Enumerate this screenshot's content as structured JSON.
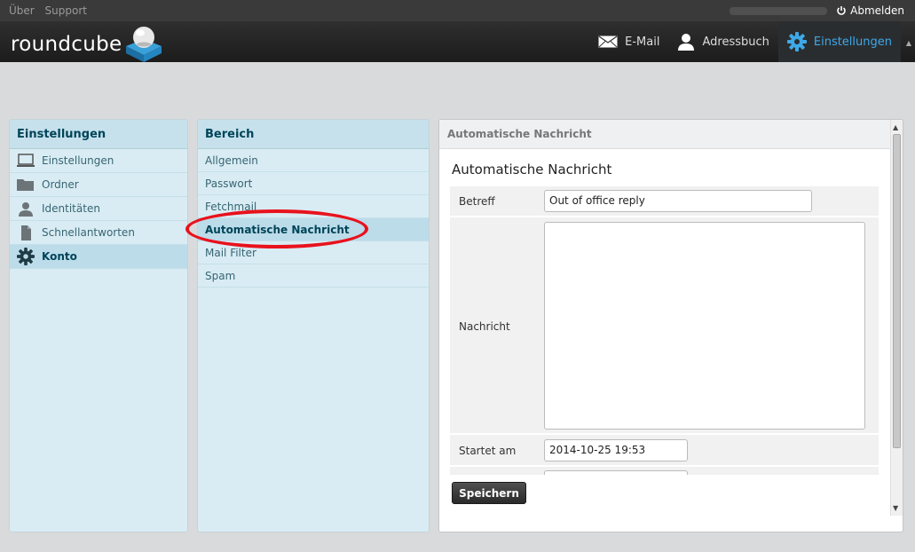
{
  "topbar": {
    "links": [
      "Über",
      "Support"
    ],
    "logout_label": "Abmelden"
  },
  "header": {
    "logo_text": "roundcube",
    "nav": [
      {
        "label": "E-Mail",
        "icon": "envelope-icon"
      },
      {
        "label": "Adressbuch",
        "icon": "person-icon"
      },
      {
        "label": "Einstellungen",
        "icon": "gear-icon",
        "active": true
      }
    ]
  },
  "settings_panel": {
    "title": "Einstellungen",
    "items": [
      {
        "label": "Einstellungen",
        "icon": "monitor-icon"
      },
      {
        "label": "Ordner",
        "icon": "folder-icon"
      },
      {
        "label": "Identitäten",
        "icon": "identity-icon"
      },
      {
        "label": "Schnellantworten",
        "icon": "document-icon"
      },
      {
        "label": "Konto",
        "icon": "gear-icon",
        "selected": true
      }
    ]
  },
  "section_panel": {
    "title": "Bereich",
    "items": [
      {
        "label": "Allgemein"
      },
      {
        "label": "Passwort"
      },
      {
        "label": "Fetchmail"
      },
      {
        "label": "Automatische Nachricht",
        "selected": true
      },
      {
        "label": "Mail Filter"
      },
      {
        "label": "Spam"
      }
    ]
  },
  "main": {
    "header": "Automatische Nachricht",
    "title": "Automatische Nachricht",
    "fields": {
      "subject_label": "Betreff",
      "subject_value": "Out of office reply",
      "message_label": "Nachricht",
      "message_value": "",
      "start_label": "Startet am",
      "start_value": "2014-10-25 19:53"
    },
    "save_label": "Speichern"
  },
  "colors": {
    "accent": "#3ea9e8",
    "highlight_circle": "#e8121c",
    "panel_bg": "#d9ecf4"
  }
}
